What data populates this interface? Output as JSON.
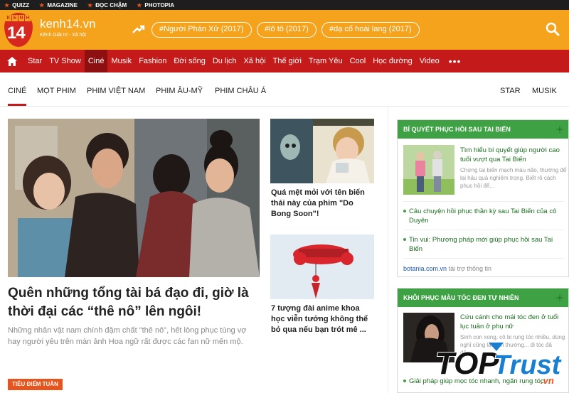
{
  "topbar": {
    "items": [
      "QUIZZ",
      "MAGAZINE",
      "ĐỌC CHẬM",
      "PHOTOPIA"
    ]
  },
  "header": {
    "logo_letters": [
      "K",
      "E",
      "N",
      "H"
    ],
    "logo_number": "14",
    "site_name": "kenh14.vn",
    "site_sub": "Kênh Giải trí - Xã hội",
    "tags": [
      "#Người Phán Xử (2017)",
      "#lô tô (2017)",
      "#dạ cổ hoài lang (2017)"
    ]
  },
  "nav": {
    "items": [
      "Star",
      "TV Show",
      "Ciné",
      "Musik",
      "Fashion",
      "Đời sống",
      "Du lịch",
      "Xã hội",
      "Thế giới",
      "Trạm Yêu",
      "Cool",
      "Học đường",
      "Video"
    ],
    "active": "Ciné",
    "more": "•••"
  },
  "subnav": {
    "items": [
      "CINÉ",
      "MỌT PHIM",
      "PHIM VIỆT NAM",
      "PHIM ÂU-MỸ",
      "PHIM CHÂU Á"
    ],
    "right": [
      "STAR",
      "MUSIK"
    ]
  },
  "hero": {
    "title": "Quên những tổng tài bá đạo đi, giờ là thời đại các “thê nô” lên ngôi!",
    "sapo": "Những nhân vật nam chính đậm chất \"thê nô\", hết lòng phục tùng vợ hay người yêu trên màn ảnh Hoa ngữ rất được các fan nữ mến mộ."
  },
  "side_articles": [
    {
      "title": "Quá mệt mỏi với tên biến thái này của phim \"Do Bong Soon\"!"
    },
    {
      "title": "7 tượng đài anime khoa học viễn tưởng không thể bỏ qua nếu bạn trót mê ..."
    }
  ],
  "badge": "TIÊU ĐIỂM TUẦN",
  "ad1": {
    "header": "BÍ QUYẾT PHỤC HỒI SAU TAI BIẾN",
    "title": "Tìm hiểu bí quyết giúp người cao tuổi vượt qua Tai Biến",
    "desc": "Chứng tai biến mạch máu não, thường để lại hậu quả nghiêm trọng. Biết rõ cách phục hồi để...",
    "items": [
      "Câu chuyện hồi phục thần kỳ sau Tai Biến của cô Duyên",
      "Tin vui: Phương pháp mới giúp phục hồi sau Tai Biến"
    ],
    "source_link": "botania.com.vn",
    "source_text": "tài trợ thông tin"
  },
  "ad2": {
    "header": "KHÔI PHỤC MÀU TÓC ĐEN TỰ NHIÊN",
    "title": "Cứu cánh cho mái tóc đen ở tuổi lục tuần ở phụ nữ",
    "desc": "Sinh con xong, cô bị rụng tóc nhiều, dùng nghĩ cũng là bình thường... đi tóc đã dầu...",
    "items": [
      "Giải pháp giúp mọc tóc nhanh, ngăn rụng tóc"
    ]
  },
  "watermark": {
    "word1": "TOP",
    "word2": "Trust",
    "suffix": ".vn"
  },
  "colors": {
    "header": "#f5a21c",
    "nav": "#c41a1a",
    "nav_active": "#8e0f0f",
    "ad_green": "#3ea143",
    "badge": "#e8541e"
  }
}
